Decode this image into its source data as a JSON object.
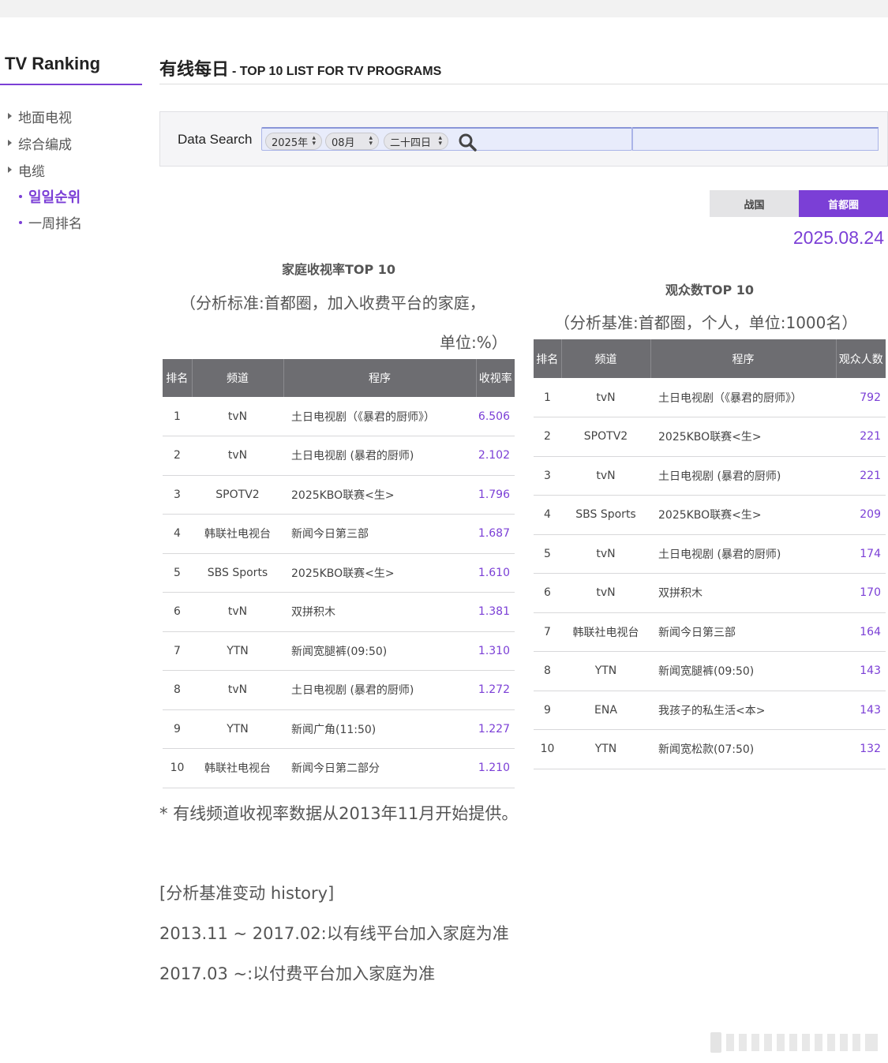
{
  "sidebar": {
    "title": "TV Ranking",
    "items": [
      "地面电视",
      "综合编成",
      "电缆"
    ],
    "subitems": [
      {
        "label": "일일순위",
        "active": true
      },
      {
        "label": "一周排名",
        "active": false
      }
    ]
  },
  "header": {
    "title": "有线每日",
    "subtitle": "- TOP 10 LIST FOR TV PROGRAMS"
  },
  "search": {
    "label": "Data Search",
    "year": "2025年",
    "month": "08月",
    "day": "二十四日"
  },
  "region_tabs": {
    "nationwide": "战国",
    "capital": "首都圈",
    "selected": "首都圈"
  },
  "date": "2025.08.24",
  "household": {
    "title": "家庭收视率TOP 10",
    "sub_line1": "（分析标准:首都圈，加入收费平台的家庭，",
    "sub_line2": "单位:%）",
    "headers": [
      "排名",
      "频道",
      "程序",
      "收视率"
    ],
    "rows": [
      [
        "1",
        "tvN",
        "土日电视剧（《暴君的厨师》）",
        "6.506"
      ],
      [
        "2",
        "tvN",
        "土日电视剧 (暴君的厨师)",
        "2.102"
      ],
      [
        "3",
        "SPOTV2",
        "2025KBO联赛<生>",
        "1.796"
      ],
      [
        "4",
        "韩联社电视台",
        "新闻今日第三部",
        "1.687"
      ],
      [
        "5",
        "SBS Sports",
        "2025KBO联赛<生>",
        "1.610"
      ],
      [
        "6",
        "tvN",
        "双拼积木",
        "1.381"
      ],
      [
        "7",
        "YTN",
        "新闻宽腿裤(09:50)",
        "1.310"
      ],
      [
        "8",
        "tvN",
        "土日电视剧 (暴君的厨师)",
        "1.272"
      ],
      [
        "9",
        "YTN",
        "新闻广角(11:50)",
        "1.227"
      ],
      [
        "10",
        "韩联社电视台",
        "新闻今日第二部分",
        "1.210"
      ]
    ]
  },
  "viewers": {
    "title": "观众数TOP 10",
    "sub_line1": "（分析基准:首都圈，个人，单位:1000名）",
    "headers": [
      "排名",
      "频道",
      "程序",
      "观众人数"
    ],
    "rows": [
      [
        "1",
        "tvN",
        "土日电视剧（《暴君的厨师》）",
        "792"
      ],
      [
        "2",
        "SPOTV2",
        "2025KBO联赛<生>",
        "221"
      ],
      [
        "3",
        "tvN",
        "土日电视剧 (暴君的厨师)",
        "221"
      ],
      [
        "4",
        "SBS Sports",
        "2025KBO联赛<生>",
        "209"
      ],
      [
        "5",
        "tvN",
        "土日电视剧 (暴君的厨师)",
        "174"
      ],
      [
        "6",
        "tvN",
        "双拼积木",
        "170"
      ],
      [
        "7",
        "韩联社电视台",
        "新闻今日第三部",
        "164"
      ],
      [
        "8",
        "YTN",
        "新闻宽腿裤(09:50)",
        "143"
      ],
      [
        "9",
        "ENA",
        "我孩子的私生活<本>",
        "143"
      ],
      [
        "10",
        "YTN",
        "新闻宽松款(07:50)",
        "132"
      ]
    ]
  },
  "footnote": "* 有线频道收视率数据从2013年11月开始提供。",
  "history": {
    "title": "[分析基准变动 history]",
    "line1": "2013.11 ~ 2017.02:以有线平台加入家庭为准",
    "line2": "2017.03 ~:以付费平台加入家庭为准"
  },
  "colors": {
    "accent": "#7b3fd6",
    "header_bg": "#6d6d71"
  }
}
